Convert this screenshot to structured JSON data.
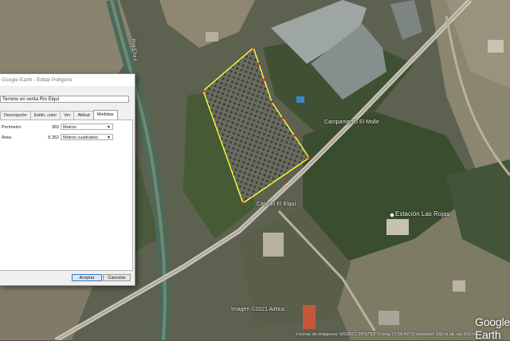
{
  "map": {
    "river_label": "Río Elqui",
    "place_labels": [
      "Campamento El Molle",
      "Cálculo El Elqui",
      "Estación Las Rojas"
    ],
    "copyright": "Imagen ©2021 Airbus",
    "logo": "Google Earth",
    "status_bar": "Fechas de imágenes: 9/6/2021    29°57'83\" S   long   71°06'42\" O   elevación 182 m   alt. ojo  200 m"
  },
  "dialog": {
    "title": "Google Earth - Editar Polígono",
    "name_value": "Terreno en venta Río Elqui",
    "tabs": [
      {
        "label": "Descripción",
        "active": false
      },
      {
        "label": "Estilo, color",
        "active": false
      },
      {
        "label": "Ver",
        "active": false
      },
      {
        "label": "Altitud",
        "active": false
      },
      {
        "label": "Medidas",
        "active": true
      }
    ],
    "measurements": {
      "perimeter_label": "Perímetro:",
      "perimeter_value": "383",
      "perimeter_unit": "Metros",
      "area_label": "Área:",
      "area_value": "8.352",
      "area_unit": "Metros cuadrados"
    },
    "accept_label": "Aceptar",
    "cancel_label": "Cancelar"
  },
  "colors": {
    "polygon_outline": "#ffff33",
    "vertex_marker": "#e02020",
    "accent": "#2a7ad6"
  }
}
